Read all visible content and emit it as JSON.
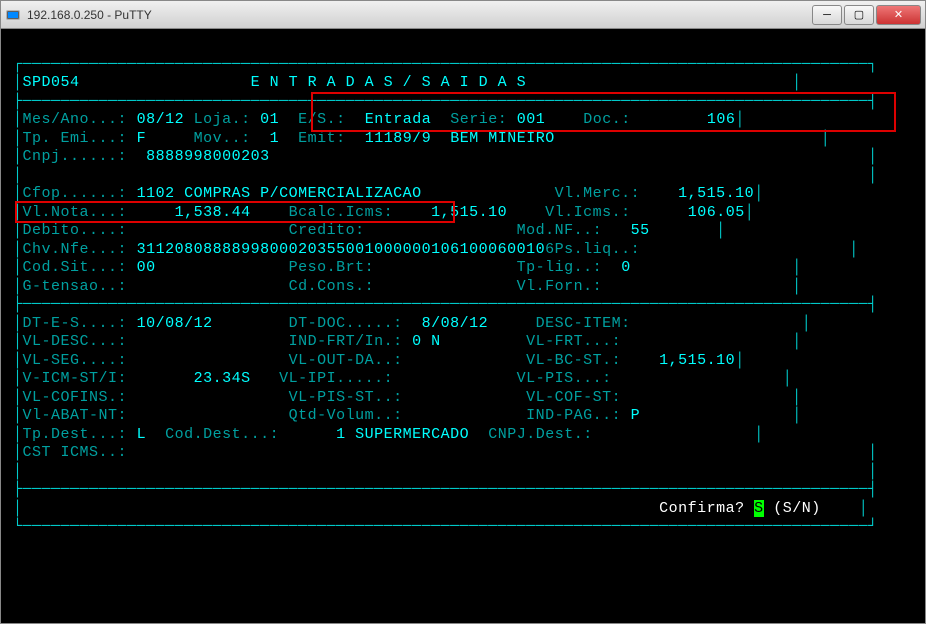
{
  "window": {
    "title": "192.168.0.250 - PuTTY"
  },
  "screen": {
    "program_id": "SPD054",
    "title": "E N T R A D A S / S A I D A S"
  },
  "header": {
    "mes_ano_label": "Mes/Ano...:",
    "mes_ano": "08/12",
    "loja_label": "Loja.:",
    "loja": "01",
    "es_label": "E/S.:",
    "es": "Entrada",
    "serie_label": "Serie:",
    "serie": "001",
    "doc_label": "Doc.:",
    "doc": "106",
    "tp_emi_label": "Tp. Emi...:",
    "tp_emi": "F",
    "mov_label": "Mov..:",
    "mov": "1",
    "emit_label": "Emit:",
    "emit_code": "11189/9",
    "emit_name": "BEM MINEIRO",
    "cnpj_label": "Cnpj......:",
    "cnpj": "8888998000203"
  },
  "body": {
    "cfop_label": "Cfop......:",
    "cfop": "1102 COMPRAS P/COMERCIALIZACAO",
    "vl_merc_label": "Vl.Merc.:",
    "vl_merc": "1,515.10",
    "vl_nota_label": "Vl.Nota...:",
    "vl_nota": "1,538.44",
    "bcalc_label": "Bcalc.Icms:",
    "bcalc": "1,515.10",
    "vl_icms_label": "Vl.Icms.:",
    "vl_icms": "106.05",
    "debito_label": "Debito....:",
    "credito_label": "Credito:",
    "mod_nf_label": "Mod.NF..:",
    "mod_nf": "55",
    "chv_nfe_label": "Chv.Nfe...:",
    "chv_nfe": "3112080888899800020355001000000106100060010",
    "ps_liq_label": "6Ps.liq..:",
    "cod_sit_label": "Cod.Sit...:",
    "cod_sit": "00",
    "peso_brt_label": "Peso.Brt:",
    "tp_lig_label": "Tp-lig..:",
    "tp_lig": "0",
    "g_tensao_label": "G-tensao..:",
    "cd_cons_label": "Cd.Cons.:",
    "vl_forn_label": "Vl.Forn.:"
  },
  "detail": {
    "dt_es_label": "DT-E-S....:",
    "dt_es": "10/08/12",
    "dt_doc_label": "DT-DOC.....:",
    "dt_doc": "8/08/12",
    "desc_item_label": "DESC-ITEM:",
    "vl_desc_label": "VL-DESC...:",
    "ind_frt_label": "IND-FRT/In.:",
    "ind_frt": "0 N",
    "vl_frt_label": "VL-FRT...:",
    "vl_seg_label": "VL-SEG....:",
    "vl_out_da_label": "VL-OUT-DA..:",
    "vl_bc_st_label": "VL-BC-ST.:",
    "vl_bc_st": "1,515.10",
    "v_icm_st_label": "V-ICM-ST/I:",
    "v_icm_st": "23.34S",
    "vl_ipi_label": "VL-IPI.....:",
    "vl_pis_label": "VL-PIS...:",
    "vl_cofins_label": "VL-COFINS.:",
    "vl_pis_st_label": "VL-PIS-ST..:",
    "vl_cof_st_label": "VL-COF-ST:",
    "vl_abat_nt_label": "Vl-ABAT-NT:",
    "qtd_volum_label": "Qtd-Volum..:",
    "ind_pag_label": "IND-PAG..:",
    "ind_pag": "P",
    "tp_dest_label": "Tp.Dest...:",
    "tp_dest": "L",
    "cod_dest_label": "Cod.Dest...:",
    "cod_dest": "1 SUPERMERCADO",
    "cnpj_dest_label": "CNPJ.Dest.:",
    "cst_icms_label": "CST ICMS..:"
  },
  "footer": {
    "confirm_label": "Confirma?",
    "confirm_value": "S",
    "confirm_options": "(S/N)"
  }
}
